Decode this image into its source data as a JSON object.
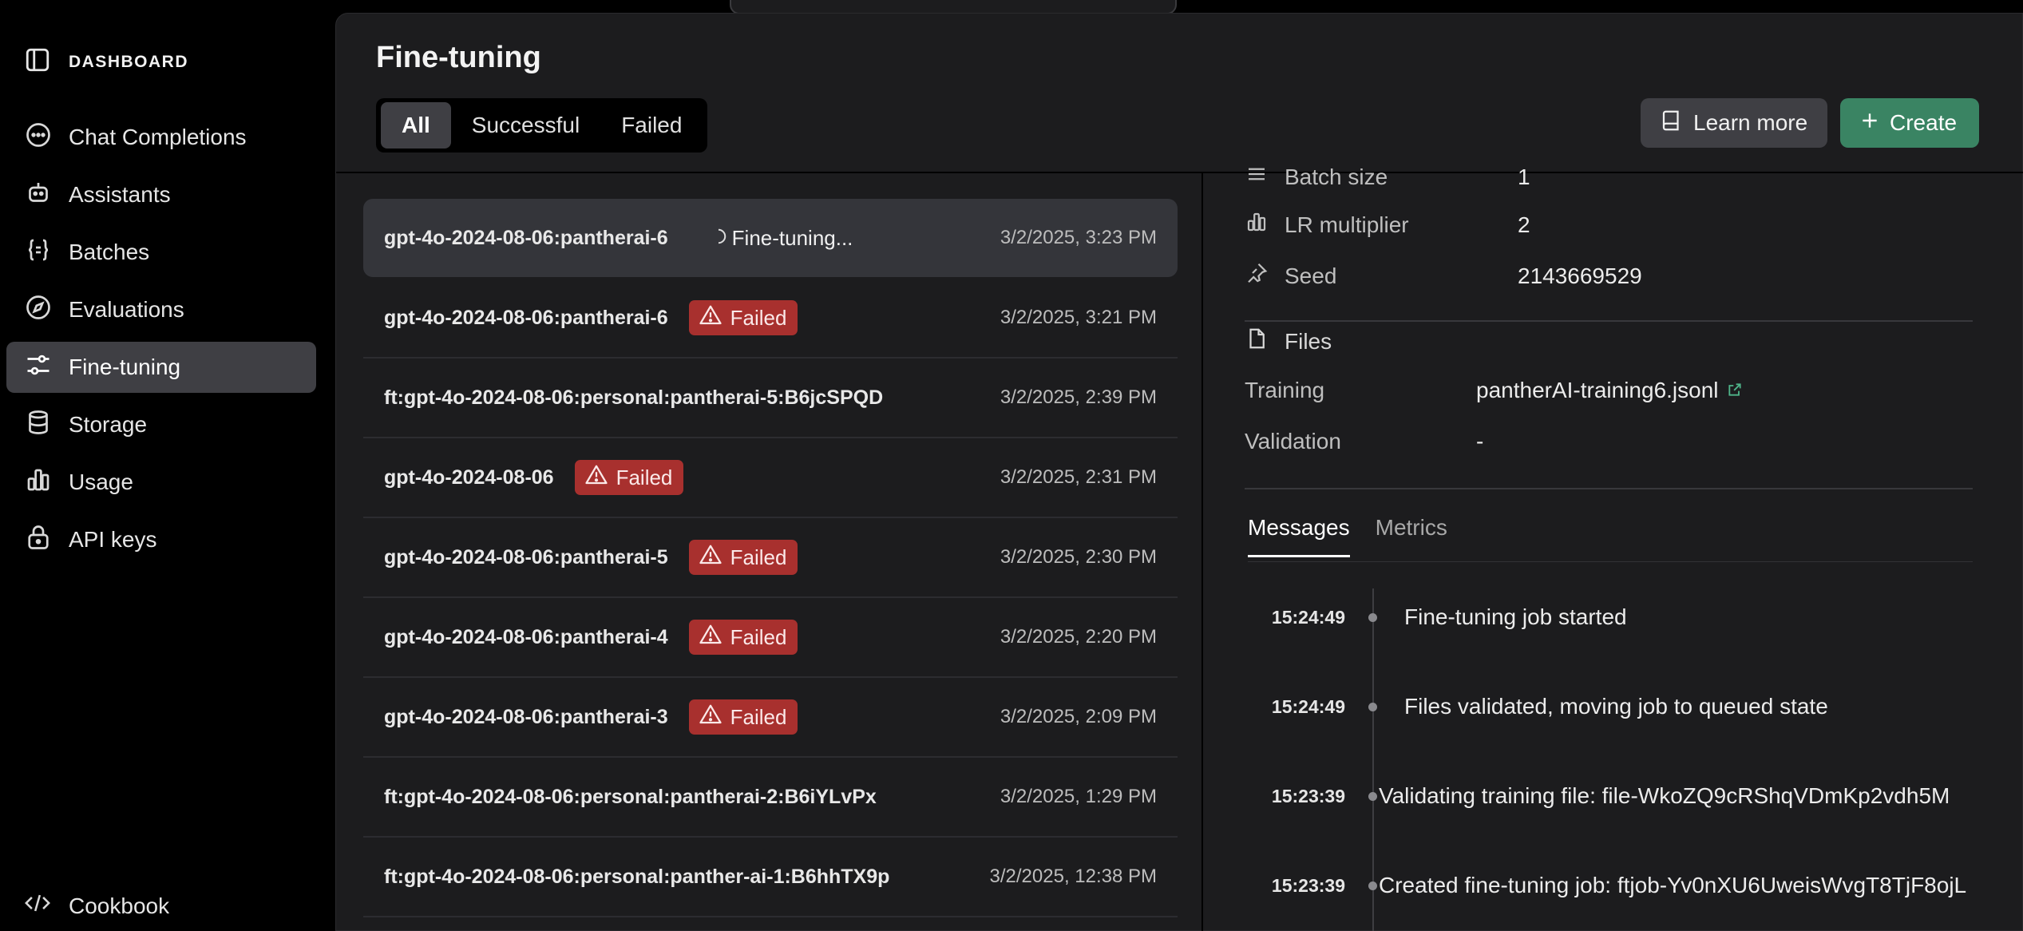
{
  "sidebar": {
    "header_title": "DASHBOARD",
    "items": [
      {
        "label": "Chat Completions",
        "icon": "chat-bubble-icon"
      },
      {
        "label": "Assistants",
        "icon": "robot-icon"
      },
      {
        "label": "Batches",
        "icon": "braces-icon"
      },
      {
        "label": "Evaluations",
        "icon": "compass-icon"
      },
      {
        "label": "Fine-tuning",
        "icon": "sliders-icon",
        "active": true
      },
      {
        "label": "Storage",
        "icon": "database-icon"
      },
      {
        "label": "Usage",
        "icon": "bar-chart-icon"
      },
      {
        "label": "API keys",
        "icon": "lock-icon"
      }
    ],
    "footer_label": "Cookbook"
  },
  "header": {
    "title": "Fine-tuning",
    "tabs": [
      "All",
      "Successful",
      "Failed"
    ],
    "active_tab": "All",
    "learn_more": "Learn more",
    "create": "Create"
  },
  "jobs": [
    {
      "name": "gpt-4o-2024-08-06:pantherai-6",
      "status": "Fine-tuning...",
      "date": "3/2/2025, 3:23 PM"
    },
    {
      "name": "gpt-4o-2024-08-06:pantherai-6",
      "status": "Failed",
      "date": "3/2/2025, 3:21 PM"
    },
    {
      "name": "ft:gpt-4o-2024-08-06:personal:pantherai-5:B6jcSPQD",
      "status": "",
      "date": "3/2/2025, 2:39 PM"
    },
    {
      "name": "gpt-4o-2024-08-06",
      "status": "Failed",
      "date": "3/2/2025, 2:31 PM"
    },
    {
      "name": "gpt-4o-2024-08-06:pantherai-5",
      "status": "Failed",
      "date": "3/2/2025, 2:30 PM"
    },
    {
      "name": "gpt-4o-2024-08-06:pantherai-4",
      "status": "Failed",
      "date": "3/2/2025, 2:20 PM"
    },
    {
      "name": "gpt-4o-2024-08-06:pantherai-3",
      "status": "Failed",
      "date": "3/2/2025, 2:09 PM"
    },
    {
      "name": "ft:gpt-4o-2024-08-06:personal:pantherai-2:B6iYLvPx",
      "status": "",
      "date": "3/2/2025, 1:29 PM"
    },
    {
      "name": "ft:gpt-4o-2024-08-06:personal:panther-ai-1:B6hhTX9p",
      "status": "",
      "date": "3/2/2025, 12:38 PM"
    }
  ],
  "detail": {
    "batch_size_label": "Batch size",
    "batch_size_value": "1",
    "lr_label": "LR multiplier",
    "lr_value": "2",
    "seed_label": "Seed",
    "seed_value": "2143669529",
    "files_label": "Files",
    "training_label": "Training",
    "training_value": "pantherAI-training6.jsonl",
    "validation_label": "Validation",
    "validation_value": "-",
    "tabs": [
      "Messages",
      "Metrics"
    ],
    "active_tab": "Messages"
  },
  "events": [
    {
      "time": "15:24:49",
      "message": "Fine-tuning job started"
    },
    {
      "time": "15:24:49",
      "message": "Files validated, moving job to queued state"
    },
    {
      "time": "15:23:39",
      "message": "Validating training file: file-WkoZQ9cRShqVDmKp2vdh5M"
    },
    {
      "time": "15:23:39",
      "message": "Created fine-tuning job: ftjob-Yv0nXU6UweisWvgT8TjF8ojL"
    }
  ],
  "colors": {
    "accent_green": "#3a8463",
    "link_green": "#4fb58a",
    "failed_red": "#a8302e"
  }
}
